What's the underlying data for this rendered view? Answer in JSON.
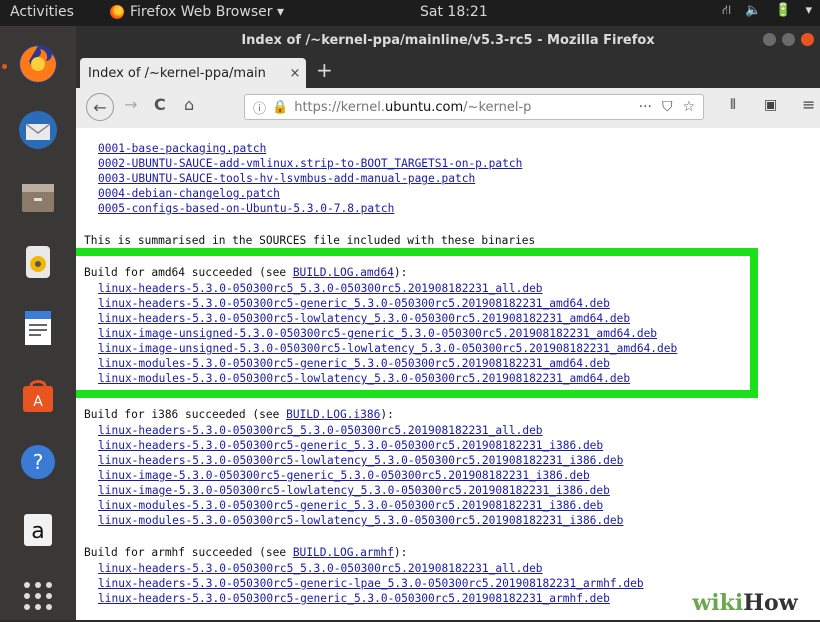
{
  "topbar": {
    "activities": "Activities",
    "app_menu": "Firefox Web Browser ▾",
    "clock": "Sat 18:21",
    "tray": [
      "⛙",
      "🔈",
      "🔋",
      "▾"
    ]
  },
  "window": {
    "title": "Index of /~kernel-ppa/mainline/v5.3-rc5 - Mozilla Firefox"
  },
  "tab": {
    "label": "Index of /~kernel-ppa/main",
    "close": "×",
    "new_tab": "+"
  },
  "nav": {
    "back": "←",
    "forward": "→",
    "reload": "C",
    "home": "⌂",
    "info": "ⓘ",
    "lock": "🔒",
    "url_prefix": "https://kernel.",
    "url_domain": "ubuntu.com",
    "url_suffix": "/~kernel-p",
    "more": "···",
    "pocket": "⛉",
    "bookmark": "☆",
    "library": "⫴",
    "sidebar": "▣",
    "menu": "≡"
  },
  "content": {
    "patches": [
      "0001-base-packaging.patch",
      "0002-UBUNTU-SAUCE-add-vmlinux.strip-to-BOOT_TARGETS1-on-p.patch",
      "0003-UBUNTU-SAUCE-tools-hv-lsvmbus-add-manual-page.patch",
      "0004-debian-changelog.patch",
      "0005-configs-based-on-Ubuntu-5.3.0-7.8.patch"
    ],
    "summary": "This is summarised in the SOURCES file included with these binaries",
    "amd64": {
      "prefix": "Build for amd64 succeeded (see ",
      "log": "BUILD.LOG.amd64",
      "suffix": "):",
      "files": [
        "linux-headers-5.3.0-050300rc5_5.3.0-050300rc5.201908182231_all.deb",
        "linux-headers-5.3.0-050300rc5-generic_5.3.0-050300rc5.201908182231_amd64.deb",
        "linux-headers-5.3.0-050300rc5-lowlatency_5.3.0-050300rc5.201908182231_amd64.deb",
        "linux-image-unsigned-5.3.0-050300rc5-generic_5.3.0-050300rc5.201908182231_amd64.deb",
        "linux-image-unsigned-5.3.0-050300rc5-lowlatency_5.3.0-050300rc5.201908182231_amd64.deb",
        "linux-modules-5.3.0-050300rc5-generic_5.3.0-050300rc5.201908182231_amd64.deb",
        "linux-modules-5.3.0-050300rc5-lowlatency_5.3.0-050300rc5.201908182231_amd64.deb"
      ]
    },
    "i386": {
      "prefix": "Build for i386 succeeded (see ",
      "log": "BUILD.LOG.i386",
      "suffix": "):",
      "files": [
        "linux-headers-5.3.0-050300rc5_5.3.0-050300rc5.201908182231_all.deb",
        "linux-headers-5.3.0-050300rc5-generic_5.3.0-050300rc5.201908182231_i386.deb",
        "linux-headers-5.3.0-050300rc5-lowlatency_5.3.0-050300rc5.201908182231_i386.deb",
        "linux-image-5.3.0-050300rc5-generic_5.3.0-050300rc5.201908182231_i386.deb",
        "linux-image-5.3.0-050300rc5-lowlatency_5.3.0-050300rc5.201908182231_i386.deb",
        "linux-modules-5.3.0-050300rc5-generic_5.3.0-050300rc5.201908182231_i386.deb",
        "linux-modules-5.3.0-050300rc5-lowlatency_5.3.0-050300rc5.201908182231_i386.deb"
      ]
    },
    "armhf": {
      "prefix": "Build for armhf succeeded (see ",
      "log": "BUILD.LOG.armhf",
      "suffix": "):",
      "files": [
        "linux-headers-5.3.0-050300rc5_5.3.0-050300rc5.201908182231_all.deb",
        "linux-headers-5.3.0-050300rc5-generic-lpae_5.3.0-050300rc5.201908182231_armhf.deb",
        "linux-headers-5.3.0-050300rc5-generic_5.3.0-050300rc5.201908182231_armhf.deb"
      ]
    }
  },
  "watermark": {
    "part1": "wiki",
    "part2": "How"
  },
  "colors": {
    "highlight": "#19e019",
    "link": "#1a1aa6",
    "ubuntu_orange": "#e95420"
  }
}
